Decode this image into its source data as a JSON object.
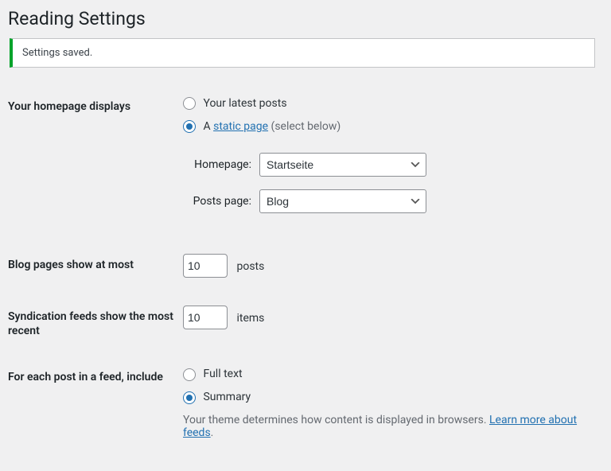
{
  "page": {
    "title": "Reading Settings",
    "notice": "Settings saved."
  },
  "homepage_displays": {
    "label": "Your homepage displays",
    "option_latest": "Your latest posts",
    "option_static_prefix": "A ",
    "option_static_link": "static page",
    "option_static_suffix": " (select below)",
    "sub": {
      "homepage_label": "Homepage:",
      "homepage_value": "Startseite",
      "posts_page_label": "Posts page:",
      "posts_page_value": "Blog"
    }
  },
  "blog_pages": {
    "label": "Blog pages show at most",
    "value": "10",
    "unit": "posts"
  },
  "syndication": {
    "label": "Syndication feeds show the most recent",
    "value": "10",
    "unit": "items"
  },
  "feed_content": {
    "label": "For each post in a feed, include",
    "option_full": "Full text",
    "option_summary": "Summary",
    "description_prefix": "Your theme determines how content is displayed in browsers. ",
    "description_link": "Learn more about feeds",
    "description_suffix": "."
  }
}
